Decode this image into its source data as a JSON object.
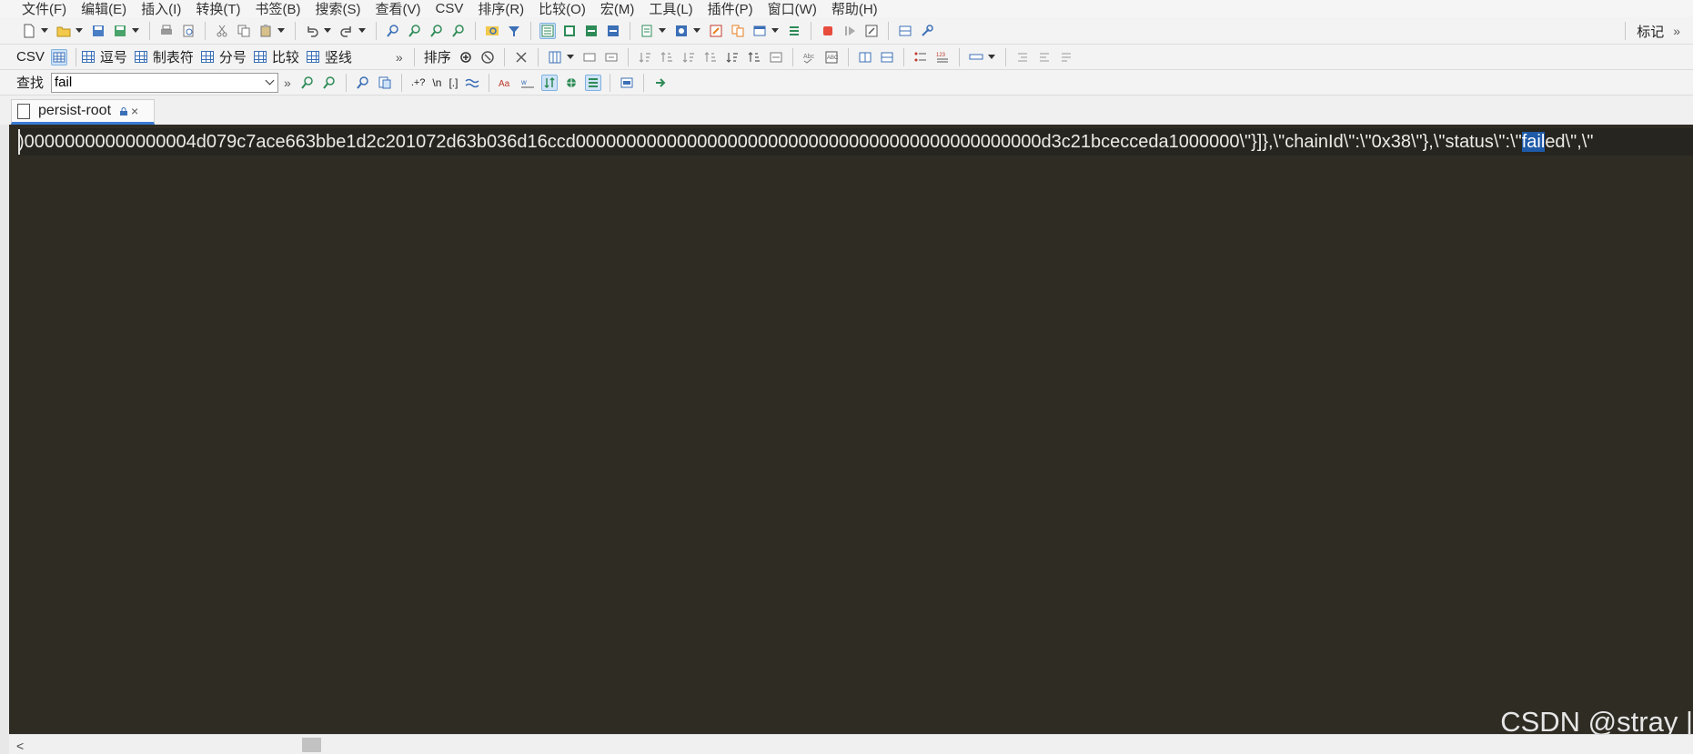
{
  "menu": [
    "文件(F)",
    "编辑(E)",
    "插入(I)",
    "转换(T)",
    "书签(B)",
    "搜索(S)",
    "查看(V)",
    "CSV",
    "排序(R)",
    "比较(O)",
    "宏(M)",
    "工具(L)",
    "插件(P)",
    "窗口(W)",
    "帮助(H)"
  ],
  "toolbar_right": {
    "label": "标记",
    "more": "»"
  },
  "csv_bar": {
    "csv_label": "CSV",
    "buttons": [
      "逗号",
      "制表符",
      "分号",
      "比较",
      "竖线"
    ],
    "more": "»",
    "sort_label": "排序"
  },
  "find_bar": {
    "label": "查找",
    "value": "fail",
    "more": "»",
    "regex_dot": ".+?",
    "newline": "\\n",
    "brackets": "[.]"
  },
  "tab": {
    "name": "persist-root",
    "close": "×"
  },
  "editor": {
    "line_before": ")00000000000000004d079c7ace663bbe1d2c201072d63b036d16ccd0000000000000000000000000000000000000000000000d3c21bcecceda1000000\\\"}]},\\\"chainId\\\":\\\"0x38\\\"},\\\"status\\\":\\\"",
    "match": "fail",
    "line_after": "ed\\\",\\\""
  },
  "watermark": "CSDN @stray |",
  "scrollbar": {
    "left_arrow": "<",
    "position": 0.17
  },
  "colors": {
    "editor_bg": "#2f2c24",
    "highlight": "#1e5aa8",
    "tab_accent": "#3a7bd5"
  }
}
